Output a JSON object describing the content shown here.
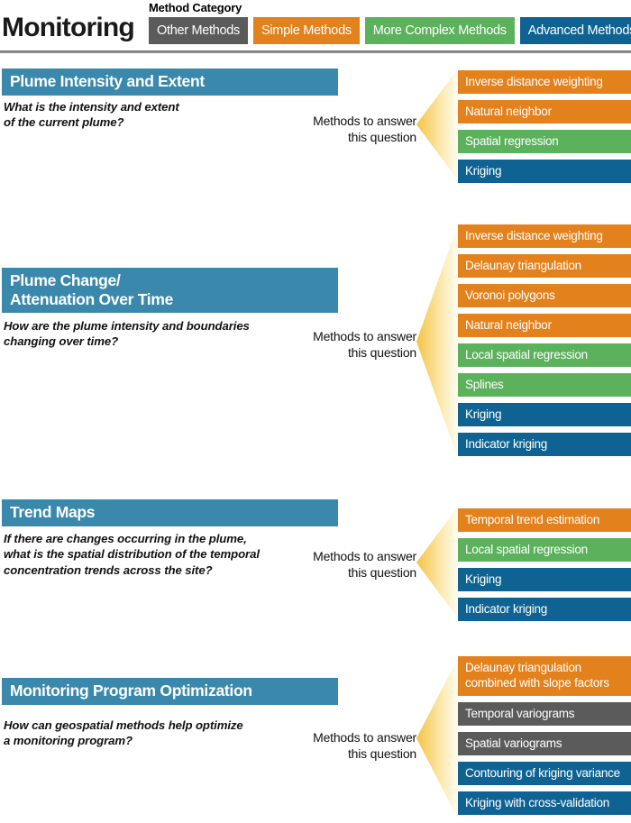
{
  "colors": {
    "other": "#5b5b5b",
    "simple": "#e3811c",
    "complex": "#5cb15d",
    "advanced": "#0f6393",
    "header_blue": "#3a88ab",
    "arrow_gold": "#f5c344",
    "arrow_pale": "#fdf3d4",
    "rule_gray": "#8d8d8d"
  },
  "legend": {
    "caption": "Method Category",
    "title": "Monitoring",
    "chips": [
      {
        "label": "Other Methods",
        "category": "other"
      },
      {
        "label": "Simple Methods",
        "category": "simple"
      },
      {
        "label": "More Complex Methods",
        "category": "complex"
      },
      {
        "label": "Advanced Methods",
        "category": "advanced"
      }
    ]
  },
  "methods_label": "Methods to answer\nthis question",
  "sections": [
    {
      "title": "Plume Intensity and Extent",
      "question": "What is the intensity and extent\nof the current plume?",
      "methods": [
        {
          "label": "Inverse distance weighting",
          "category": "simple"
        },
        {
          "label": "Natural neighbor",
          "category": "simple"
        },
        {
          "label": "Spatial regression",
          "category": "complex"
        },
        {
          "label": "Kriging",
          "category": "advanced"
        }
      ]
    },
    {
      "title": "Plume Change/\nAttenuation Over Time",
      "question": "How are the plume intensity and boundaries\nchanging over time?",
      "methods": [
        {
          "label": "Inverse distance weighting",
          "category": "simple"
        },
        {
          "label": "Delaunay triangulation",
          "category": "simple"
        },
        {
          "label": "Voronoi polygons",
          "category": "simple"
        },
        {
          "label": "Natural neighbor",
          "category": "simple"
        },
        {
          "label": "Local spatial regression",
          "category": "complex"
        },
        {
          "label": "Splines",
          "category": "complex"
        },
        {
          "label": "Kriging",
          "category": "advanced"
        },
        {
          "label": "Indicator kriging",
          "category": "advanced"
        }
      ]
    },
    {
      "title": "Trend Maps",
      "question": "If there are changes occurring in the plume,\nwhat is the spatial distribution of the temporal\nconcentration trends across the site?",
      "methods": [
        {
          "label": "Temporal trend estimation",
          "category": "simple"
        },
        {
          "label": "Local spatial regression",
          "category": "complex"
        },
        {
          "label": "Kriging",
          "category": "advanced"
        },
        {
          "label": "Indicator kriging",
          "category": "advanced"
        }
      ]
    },
    {
      "title": "Monitoring Program Optimization",
      "question": "How can geospatial methods help optimize\na monitoring program?",
      "methods": [
        {
          "label": "Delaunay triangulation\ncombined with slope factors",
          "category": "simple"
        },
        {
          "label": "Temporal variograms",
          "category": "other"
        },
        {
          "label": "Spatial variograms",
          "category": "other"
        },
        {
          "label": "Contouring of kriging variance",
          "category": "advanced"
        },
        {
          "label": "Kriging with cross-validation",
          "category": "advanced"
        }
      ]
    }
  ]
}
